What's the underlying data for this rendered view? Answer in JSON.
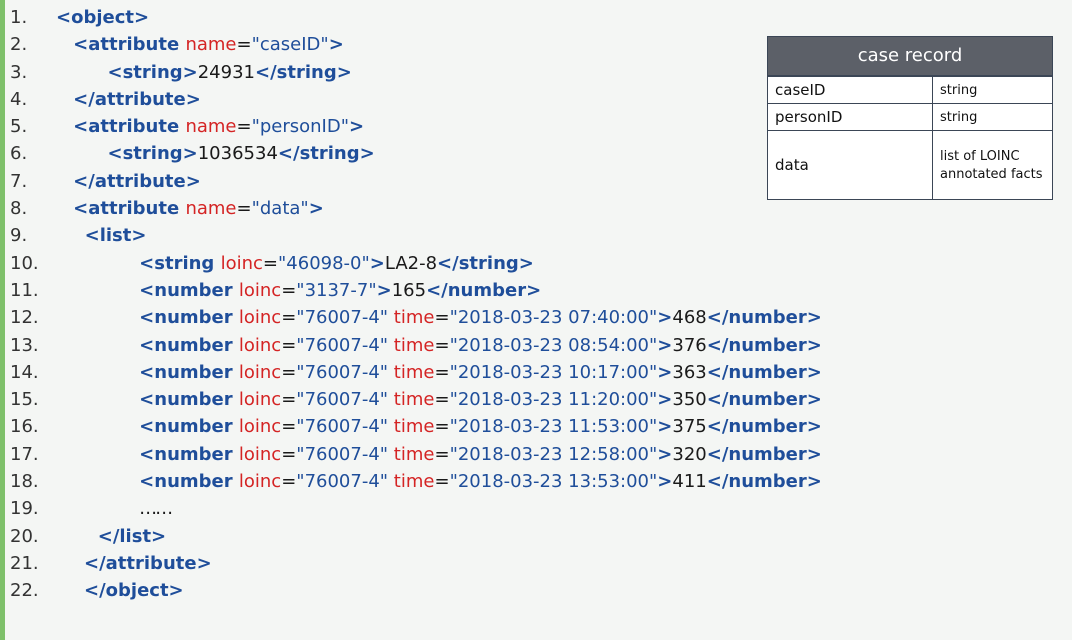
{
  "code_lines": [
    {
      "num": "1.",
      "indent": "",
      "tokens": [
        [
          "tag",
          "<object>"
        ]
      ]
    },
    {
      "num": "2.",
      "indent": "   ",
      "tokens": [
        [
          "tag",
          "<attribute "
        ],
        [
          "attr",
          "name"
        ],
        [
          "text",
          "="
        ],
        [
          "str",
          "\"caseID\""
        ],
        [
          "tag",
          ">"
        ]
      ]
    },
    {
      "num": "3.",
      "indent": "         ",
      "tokens": [
        [
          "tag",
          "<string>"
        ],
        [
          "text",
          "24931"
        ],
        [
          "tag",
          "</string>"
        ]
      ]
    },
    {
      "num": "4.",
      "indent": "   ",
      "tokens": [
        [
          "tag",
          "</attribute>"
        ]
      ]
    },
    {
      "num": "5.",
      "indent": "   ",
      "tokens": [
        [
          "tag",
          "<attribute "
        ],
        [
          "attr",
          "name"
        ],
        [
          "text",
          "="
        ],
        [
          "str",
          "\"personID\""
        ],
        [
          "tag",
          ">"
        ]
      ]
    },
    {
      "num": "6.",
      "indent": "         ",
      "tokens": [
        [
          "tag",
          "<string>"
        ],
        [
          "text",
          "1036534"
        ],
        [
          "tag",
          "</string>"
        ]
      ]
    },
    {
      "num": "7.",
      "indent": "   ",
      "tokens": [
        [
          "tag",
          "</attribute>"
        ]
      ]
    },
    {
      "num": "8.",
      "indent": "   ",
      "tokens": [
        [
          "tag",
          "<attribute "
        ],
        [
          "attr",
          "name"
        ],
        [
          "text",
          "="
        ],
        [
          "str",
          "\"data\""
        ],
        [
          "tag",
          ">"
        ]
      ]
    },
    {
      "num": "9.",
      "indent": "     ",
      "tokens": [
        [
          "tag",
          "<list>"
        ]
      ]
    },
    {
      "num": "10.",
      "indent": "   ",
      "tokens": [
        [
          "tag",
          "<string "
        ],
        [
          "attr",
          "loinc"
        ],
        [
          "text",
          "="
        ],
        [
          "str",
          "\"46098-0\""
        ],
        [
          "tag",
          ">"
        ],
        [
          "text",
          "LA2-8"
        ],
        [
          "tag",
          "</string>"
        ]
      ]
    },
    {
      "num": "11.",
      "indent": "   ",
      "tokens": [
        [
          "tag",
          "<number "
        ],
        [
          "attr",
          "loinc"
        ],
        [
          "text",
          "="
        ],
        [
          "str",
          "\"3137-7\""
        ],
        [
          "tag",
          ">"
        ],
        [
          "text",
          "165"
        ],
        [
          "tag",
          "</number>"
        ]
      ]
    },
    {
      "num": "12.",
      "indent": "   ",
      "tokens": [
        [
          "tag",
          "<number "
        ],
        [
          "attr",
          "loinc"
        ],
        [
          "text",
          "="
        ],
        [
          "str",
          "\"76007-4\" "
        ],
        [
          "attr",
          "time"
        ],
        [
          "text",
          "="
        ],
        [
          "str",
          "\"2018-03-23 07:40:00\""
        ],
        [
          "tag",
          ">"
        ],
        [
          "text",
          "468"
        ],
        [
          "tag",
          "</number>"
        ]
      ]
    },
    {
      "num": "13.",
      "indent": "   ",
      "tokens": [
        [
          "tag",
          "<number "
        ],
        [
          "attr",
          "loinc"
        ],
        [
          "text",
          "="
        ],
        [
          "str",
          "\"76007-4\" "
        ],
        [
          "attr",
          "time"
        ],
        [
          "text",
          "="
        ],
        [
          "str",
          "\"2018-03-23 08:54:00\""
        ],
        [
          "tag",
          ">"
        ],
        [
          "text",
          "376"
        ],
        [
          "tag",
          "</number>"
        ]
      ]
    },
    {
      "num": "14.",
      "indent": "   ",
      "tokens": [
        [
          "tag",
          "<number "
        ],
        [
          "attr",
          "loinc"
        ],
        [
          "text",
          "="
        ],
        [
          "str",
          "\"76007-4\" "
        ],
        [
          "attr",
          "time"
        ],
        [
          "text",
          "="
        ],
        [
          "str",
          "\"2018-03-23 10:17:00\""
        ],
        [
          "tag",
          ">"
        ],
        [
          "text",
          "363"
        ],
        [
          "tag",
          "</number>"
        ]
      ]
    },
    {
      "num": "15.",
      "indent": "   ",
      "tokens": [
        [
          "tag",
          "<number "
        ],
        [
          "attr",
          "loinc"
        ],
        [
          "text",
          "="
        ],
        [
          "str",
          "\"76007-4\" "
        ],
        [
          "attr",
          "time"
        ],
        [
          "text",
          "="
        ],
        [
          "str",
          "\"2018-03-23 11:20:00\""
        ],
        [
          "tag",
          ">"
        ],
        [
          "text",
          "350"
        ],
        [
          "tag",
          "</number>"
        ]
      ]
    },
    {
      "num": "16.",
      "indent": "   ",
      "tokens": [
        [
          "tag",
          "<number "
        ],
        [
          "attr",
          "loinc"
        ],
        [
          "text",
          "="
        ],
        [
          "str",
          "\"76007-4\" "
        ],
        [
          "attr",
          "time"
        ],
        [
          "text",
          "="
        ],
        [
          "str",
          "\"2018-03-23 11:53:00\""
        ],
        [
          "tag",
          ">"
        ],
        [
          "text",
          "375"
        ],
        [
          "tag",
          "</number>"
        ]
      ]
    },
    {
      "num": "17.",
      "indent": "   ",
      "tokens": [
        [
          "tag",
          "<number "
        ],
        [
          "attr",
          "loinc"
        ],
        [
          "text",
          "="
        ],
        [
          "str",
          "\"76007-4\" "
        ],
        [
          "attr",
          "time"
        ],
        [
          "text",
          "="
        ],
        [
          "str",
          "\"2018-03-23 12:58:00\""
        ],
        [
          "tag",
          ">"
        ],
        [
          "text",
          "320"
        ],
        [
          "tag",
          "</number>"
        ]
      ]
    },
    {
      "num": "18.",
      "indent": "   ",
      "tokens": [
        [
          "tag",
          "<number "
        ],
        [
          "attr",
          "loinc"
        ],
        [
          "text",
          "="
        ],
        [
          "str",
          "\"76007-4\" "
        ],
        [
          "attr",
          "time"
        ],
        [
          "text",
          "="
        ],
        [
          "str",
          "\"2018-03-23 13:53:00\""
        ],
        [
          "tag",
          ">"
        ],
        [
          "text",
          "411"
        ],
        [
          "tag",
          "</number>"
        ]
      ]
    },
    {
      "num": "19.",
      "indent": "   ",
      "tokens": [
        [
          "text",
          "……"
        ]
      ]
    },
    {
      "num": "20.",
      "indent": " ",
      "tokens": [
        [
          "tag",
          "</list>"
        ]
      ]
    },
    {
      "num": "21.",
      "indent": "",
      "tokens": [
        [
          "tag",
          "</attribute>"
        ]
      ]
    },
    {
      "num": "22.",
      "indent": "",
      "tokens": [
        [
          "tag",
          "</object>"
        ]
      ]
    }
  ],
  "record": {
    "title": "case record",
    "rows": [
      {
        "field": "caseID",
        "type": "string"
      },
      {
        "field": "personID",
        "type": "string"
      },
      {
        "field": "data",
        "type": "list of LOINC annotated facts"
      }
    ]
  }
}
